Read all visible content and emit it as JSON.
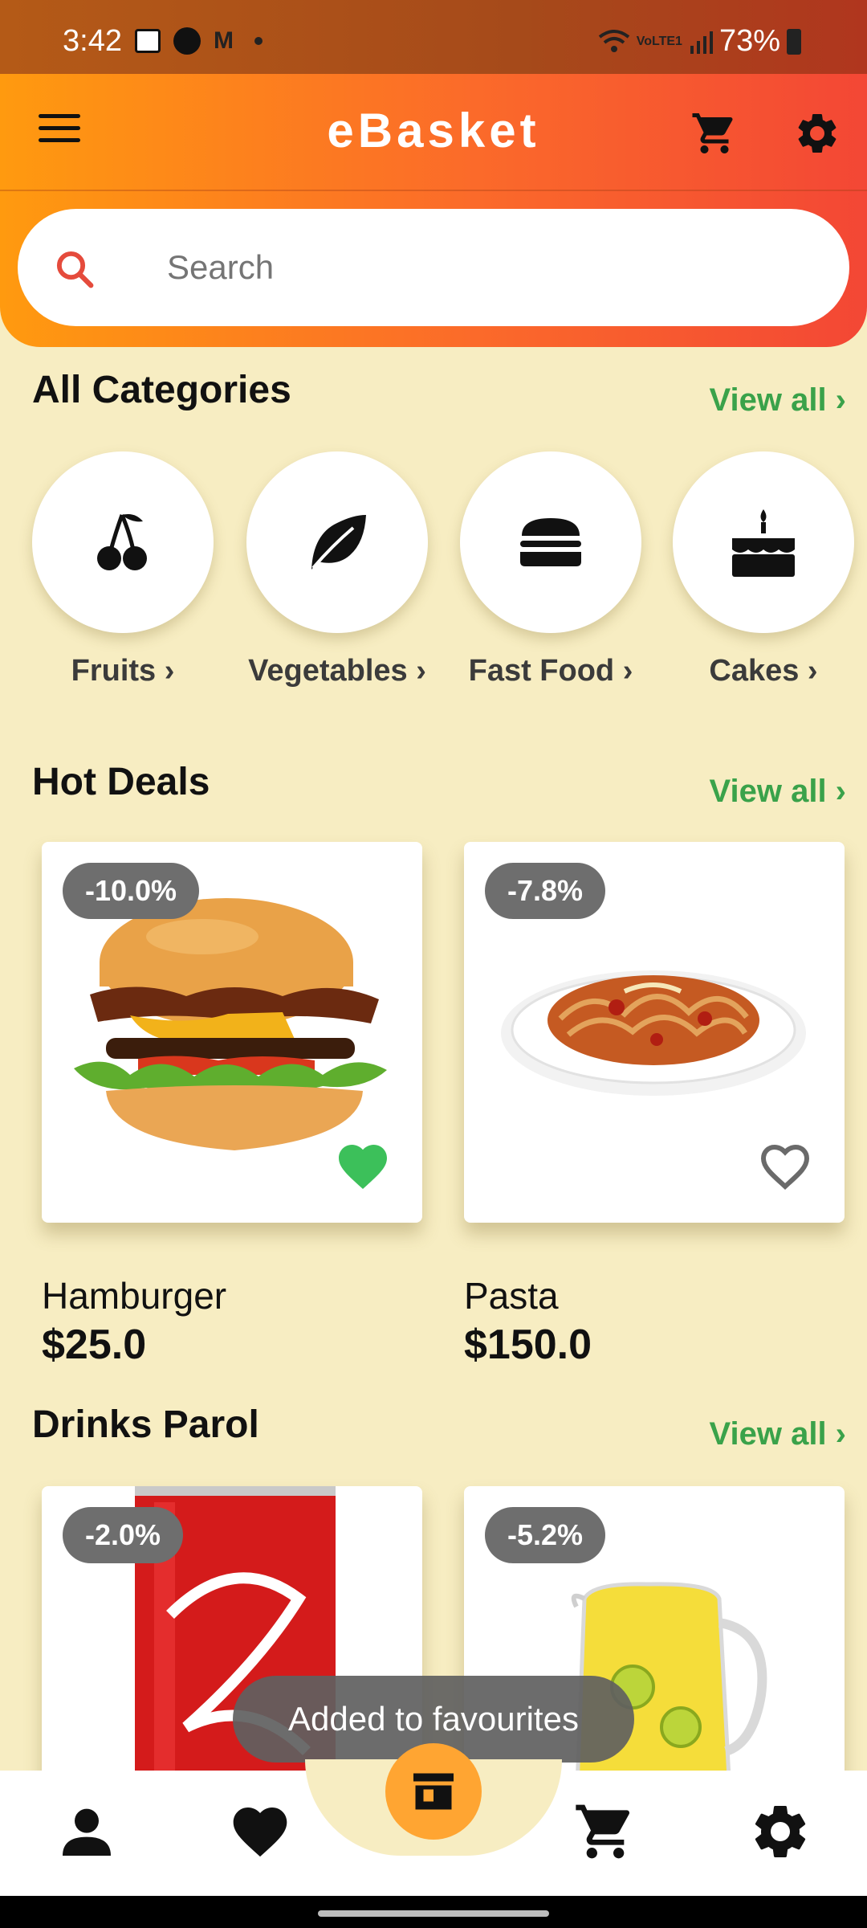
{
  "status_bar": {
    "time": "3:42",
    "battery": "73%",
    "network": "VoLTE1"
  },
  "header": {
    "menu_icon": "hamburger-menu-icon",
    "title": "eBasket",
    "cart_icon": "cart-icon",
    "settings_icon": "gear-icon",
    "gradient": [
      "#ff9a0f",
      "#f34735"
    ]
  },
  "search": {
    "placeholder": "Search",
    "value": ""
  },
  "categories": {
    "title": "All Categories",
    "view_all": "View all ›",
    "items": [
      {
        "label": "Fruits ›",
        "icon": "cherry-icon"
      },
      {
        "label": "Vegetables ›",
        "icon": "leaf-icon"
      },
      {
        "label": "Fast Food ›",
        "icon": "burger-icon"
      },
      {
        "label": "Cakes ›",
        "icon": "cake-icon"
      }
    ]
  },
  "hot_deals": {
    "title": "Hot Deals",
    "view_all": "View all ›",
    "items": [
      {
        "name": "Hamburger",
        "price": "$25.0",
        "discount": "-10.0%",
        "favourite": true,
        "image": "hamburger-image"
      },
      {
        "name": "Pasta",
        "price": "$150.0",
        "discount": "-7.8%",
        "favourite": false,
        "image": "pasta-image"
      }
    ]
  },
  "drinks": {
    "title": "Drinks Parol",
    "view_all": "View all ›",
    "items": [
      {
        "discount": "-2.0%",
        "image": "cola-can-image"
      },
      {
        "discount": "-5.2%",
        "image": "lemonade-pitcher-image"
      }
    ]
  },
  "toast": {
    "message": "Added to favourites"
  },
  "bottom_nav": {
    "items": [
      {
        "icon": "person-icon"
      },
      {
        "icon": "heart-icon"
      },
      {
        "icon": "store-icon",
        "active": true
      },
      {
        "icon": "cart-icon"
      },
      {
        "icon": "gear-icon"
      }
    ]
  },
  "colors": {
    "background": "#f7edc2",
    "accent_green": "#3aa24a",
    "fav_green": "#3cc05a",
    "center_button": "#ffa532",
    "badge": "#6e6e6e"
  }
}
